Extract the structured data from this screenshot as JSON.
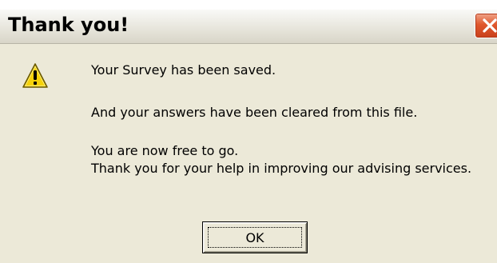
{
  "window": {
    "title": "Thank you!",
    "close_icon": "close-icon"
  },
  "icon": {
    "name": "warning-icon",
    "color": "#f5d20a"
  },
  "messages": {
    "line1": "Your Survey has been saved.",
    "line2": "And your answers have been cleared from this file.",
    "line3": "You are now free to go.",
    "line4": "Thank you for your help in improving our advising services."
  },
  "buttons": {
    "ok_label": "OK"
  },
  "colors": {
    "dialog_bg": "#ece9d8",
    "close_button": "#e0582d"
  }
}
